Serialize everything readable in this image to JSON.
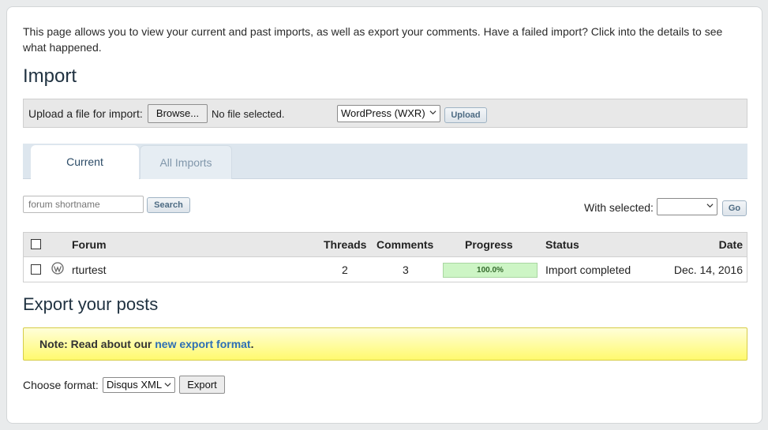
{
  "intro": "This page allows you to view your current and past imports, as well as export your comments. Have a failed import? Click into the details to see what happened.",
  "import": {
    "title": "Import",
    "upload_label": "Upload a file for import:",
    "browse_label": "Browse...",
    "no_file_text": "No file selected.",
    "format_selected": "WordPress (WXR)",
    "upload_button": "Upload"
  },
  "tabs": [
    {
      "label": "Current",
      "active": true
    },
    {
      "label": "All Imports",
      "active": false
    }
  ],
  "filter": {
    "search_placeholder": "forum shortname",
    "search_button": "Search",
    "with_selected_label": "With selected:",
    "bulk_selected": "",
    "go_button": "Go"
  },
  "table": {
    "headers": {
      "forum": "Forum",
      "threads": "Threads",
      "comments": "Comments",
      "progress": "Progress",
      "status": "Status",
      "date": "Date"
    },
    "rows": [
      {
        "forum": "rturtest",
        "threads": "2",
        "comments": "3",
        "progress": "100.0%",
        "progress_value": 1.0,
        "status": "Import completed",
        "date": "Dec. 14, 2016",
        "icon": "wordpress-icon"
      }
    ]
  },
  "export": {
    "title": "Export your posts",
    "note_prefix": "Note: Read about our ",
    "note_link": "new export format",
    "note_suffix": ".",
    "choose_label": "Choose format:",
    "format_selected": "Disqus XML",
    "export_button": "Export"
  },
  "colors": {
    "link": "#2d6fb5",
    "note_bg": "#fffa6e",
    "progress_bg": "#cdf5c5",
    "heading": "#1f3140"
  }
}
